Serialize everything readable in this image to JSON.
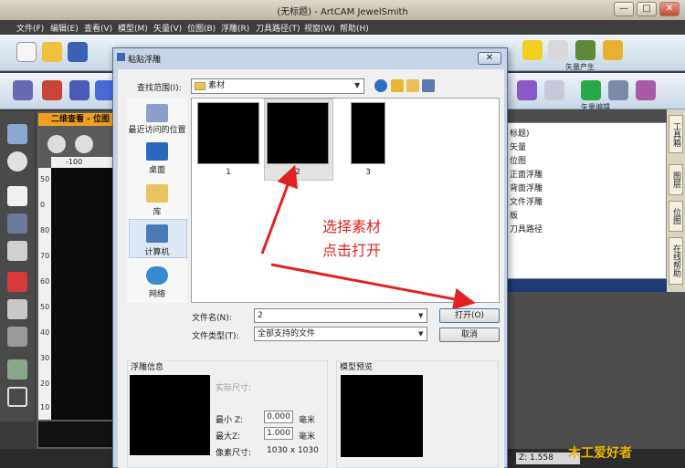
{
  "app": {
    "title": "(无标题) - ArtCAM JewelSmith",
    "minimize": "—",
    "maximize": "□",
    "close": "✕"
  },
  "menubar": [
    {
      "label": "文件(F)"
    },
    {
      "label": "编辑(E)"
    },
    {
      "label": "查看(V)"
    },
    {
      "label": "模型(M)"
    },
    {
      "label": "矢量(V)"
    },
    {
      "label": "位图(B)"
    },
    {
      "label": "浮雕(R)"
    },
    {
      "label": "刀具路径(T)"
    },
    {
      "label": "视窗(W)"
    },
    {
      "label": "帮助(H)"
    }
  ],
  "toolbar": {
    "vector_caption": "矢量产生",
    "vector_edit_caption": "矢量编辑"
  },
  "view": {
    "tab_title": "二维查看 - 位图",
    "ruler_h_value": "-100",
    "ruler_v_values": [
      "50",
      "0",
      "80",
      "70",
      "60",
      "50",
      "40",
      "30",
      "20",
      "10"
    ]
  },
  "tree": {
    "items": [
      "标题)",
      "矢量",
      "位图",
      "正面浮雕",
      "背面浮雕",
      "文件浮雕",
      "板",
      "刀具路径"
    ]
  },
  "side_tabs": [
    "工具箱",
    "图层",
    "位图",
    "在线帮助"
  ],
  "status": {
    "z_value": "Z: 1.558"
  },
  "dialog": {
    "title": "粘贴浮雕",
    "close": "✕",
    "look_in_label": "查找范围(I):",
    "look_in_value": "素材",
    "places": [
      {
        "label": "最近访问的位置",
        "icon": "recent-places-icon"
      },
      {
        "label": "桌面",
        "icon": "desktop-icon"
      },
      {
        "label": "库",
        "icon": "libraries-icon"
      },
      {
        "label": "计算机",
        "icon": "computer-icon"
      },
      {
        "label": "网络",
        "icon": "network-icon"
      }
    ],
    "files": [
      {
        "name": "1"
      },
      {
        "name": "2"
      },
      {
        "name": "3"
      }
    ],
    "annotation_line1": "选择素材",
    "annotation_line2": "点击打开",
    "file_name_label": "文件名(N):",
    "file_name_value": "2",
    "file_type_label": "文件类型(T):",
    "file_type_value": "全部支持的文件",
    "open_label": "打开(O)",
    "cancel_label": "取消",
    "relief_info_label": "浮雕信息",
    "actual_size_label": "实际尺寸:",
    "min_z_label": "最小 Z:",
    "min_z_value": "0.000",
    "min_z_unit": "毫米",
    "max_z_label": "最大Z:",
    "max_z_value": "1.000",
    "max_z_unit": "毫米",
    "pixel_size_label": "像素尺寸:",
    "pixel_size_value": "1030 x 1030",
    "model_preview_label": "模型预览"
  },
  "watermark": "木工爱好者"
}
